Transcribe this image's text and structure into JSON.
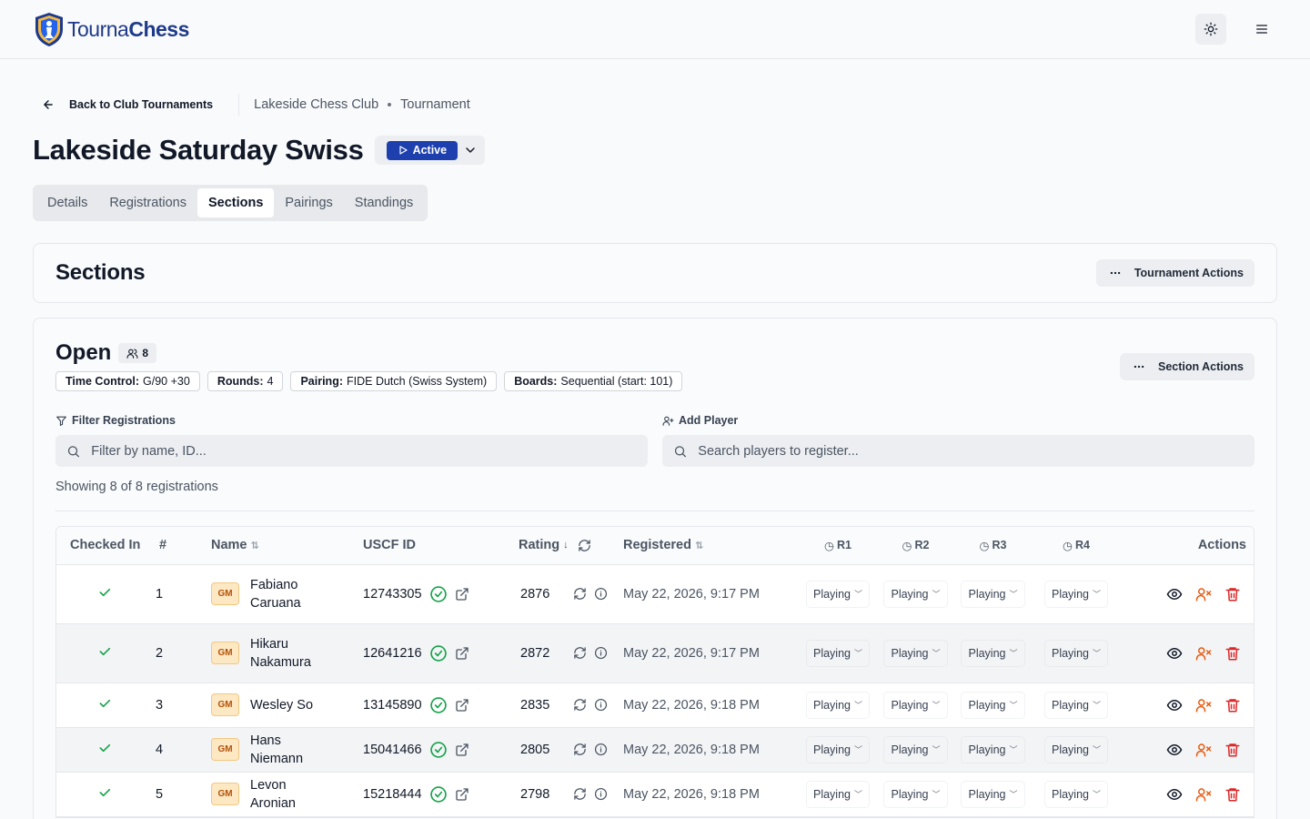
{
  "header": {
    "logo_part1": "Tourna",
    "logo_part2": "Chess",
    "theme_icon": "sun-icon",
    "menu_icon": "hamburger-icon"
  },
  "breadcrumb": {
    "back_label": "Back to Club Tournaments",
    "club": "Lakeside Chess Club",
    "page": "Tournament"
  },
  "tournament": {
    "title": "Lakeside Saturday Swiss",
    "status": "Active"
  },
  "tabs": [
    {
      "label": "Details"
    },
    {
      "label": "Registrations"
    },
    {
      "label": "Sections",
      "active": true
    },
    {
      "label": "Pairings"
    },
    {
      "label": "Standings"
    }
  ],
  "sections_card": {
    "title": "Sections",
    "actions_label": "Tournament Actions"
  },
  "section": {
    "name": "Open",
    "player_count": "8",
    "actions_label": "Section Actions",
    "chips": [
      {
        "key": "Time Control:",
        "value": "G/90 +30"
      },
      {
        "key": "Rounds:",
        "value": "4"
      },
      {
        "key": "Pairing:",
        "value": "FIDE Dutch (Swiss System)"
      },
      {
        "key": "Boards:",
        "value": "Sequential (start: 101)"
      }
    ],
    "filter_label": "Filter Registrations",
    "filter_placeholder": "Filter by name, ID...",
    "add_label": "Add Player",
    "add_placeholder": "Search players to register...",
    "showing": "Showing 8 of 8 registrations"
  },
  "table": {
    "headers": {
      "checked_in": "Checked In",
      "num": "#",
      "name": "Name",
      "uscf": "USCF ID",
      "rating": "Rating",
      "registered": "Registered",
      "r1": "R1",
      "r2": "R2",
      "r3": "R3",
      "r4": "R4",
      "actions": "Actions"
    },
    "rows": [
      {
        "num": "1",
        "title": "GM",
        "name": "Fabiano Caruana",
        "uscf": "12743305",
        "rating": "2876",
        "registered": "May 22, 2026, 9:17 PM",
        "r1": "Playing",
        "r2": "Playing",
        "r3": "Playing",
        "r4": "Playing"
      },
      {
        "num": "2",
        "title": "GM",
        "name": "Hikaru Nakamura",
        "uscf": "12641216",
        "rating": "2872",
        "registered": "May 22, 2026, 9:17 PM",
        "r1": "Playing",
        "r2": "Playing",
        "r3": "Playing",
        "r4": "Playing"
      },
      {
        "num": "3",
        "title": "GM",
        "name": "Wesley So",
        "uscf": "13145890",
        "rating": "2835",
        "registered": "May 22, 2026, 9:18 PM",
        "r1": "Playing",
        "r2": "Playing",
        "r3": "Playing",
        "r4": "Playing"
      },
      {
        "num": "4",
        "title": "GM",
        "name": "Hans Niemann",
        "uscf": "15041466",
        "rating": "2805",
        "registered": "May 22, 2026, 9:18 PM",
        "r1": "Playing",
        "r2": "Playing",
        "r3": "Playing",
        "r4": "Playing"
      },
      {
        "num": "5",
        "title": "GM",
        "name": "Levon Aronian",
        "uscf": "15218444",
        "rating": "2798",
        "registered": "May 22, 2026, 9:18 PM",
        "r1": "Playing",
        "r2": "Playing",
        "r3": "Playing",
        "r4": "Playing"
      }
    ]
  },
  "colors": {
    "brand": "#1e3a8a",
    "active": "#1e40af",
    "check": "#16a34a",
    "remove_user": "#ea580c",
    "delete": "#dc2626"
  }
}
